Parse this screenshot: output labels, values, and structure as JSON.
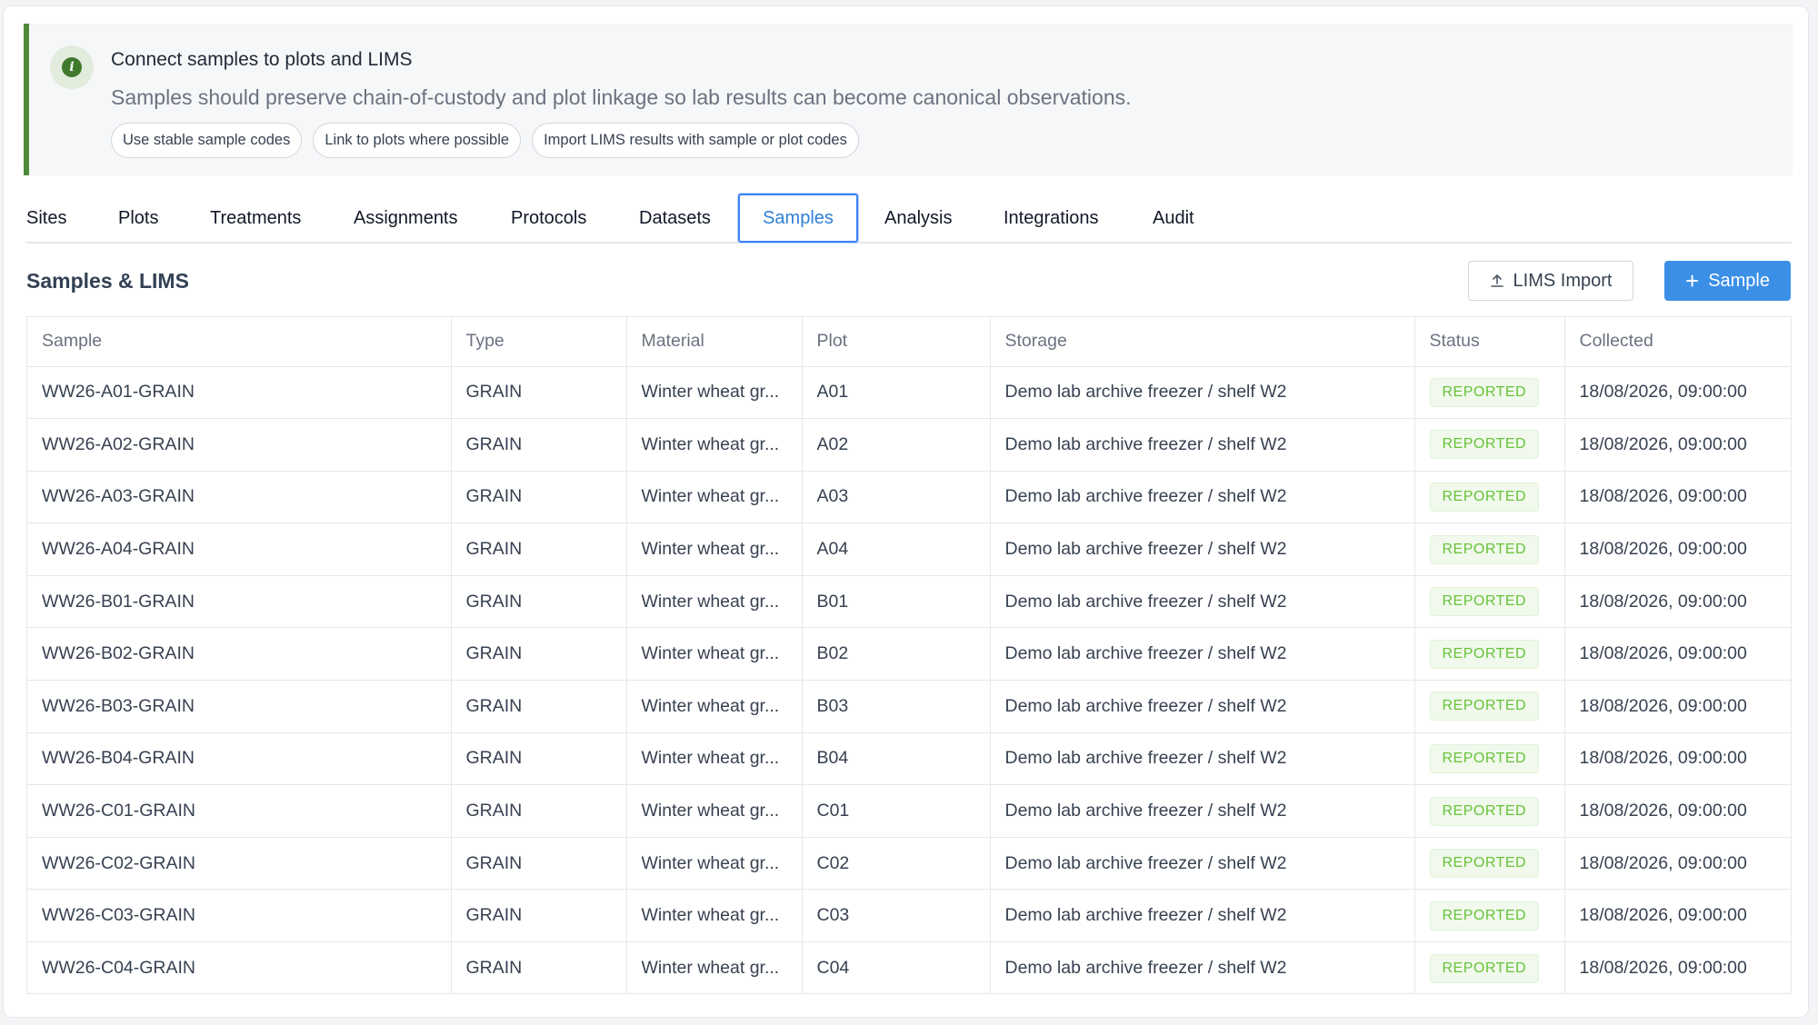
{
  "banner": {
    "title": "Connect samples to plots and LIMS",
    "description": "Samples should preserve chain-of-custody and plot linkage so lab results can become canonical observations.",
    "chips": [
      "Use stable sample codes",
      "Link to plots where possible",
      "Import LIMS results with sample or plot codes"
    ],
    "accent_color": "#4f8a3c"
  },
  "tabs": {
    "items": [
      "Sites",
      "Plots",
      "Treatments",
      "Assignments",
      "Protocols",
      "Datasets",
      "Samples",
      "Analysis",
      "Integrations",
      "Audit"
    ],
    "active": "Samples"
  },
  "section": {
    "title": "Samples & LIMS",
    "lims_import_label": "LIMS Import",
    "add_sample_label": "Sample",
    "primary_color": "#3b8fe6"
  },
  "table": {
    "columns": [
      "Sample",
      "Type",
      "Material",
      "Plot",
      "Storage",
      "Status",
      "Collected"
    ],
    "rows": [
      {
        "sample": "WW26-A01-GRAIN",
        "type": "GRAIN",
        "material": "Winter wheat gr...",
        "plot": "A01",
        "storage": "Demo lab archive freezer / shelf W2",
        "status": "REPORTED",
        "collected": "18/08/2026, 09:00:00"
      },
      {
        "sample": "WW26-A02-GRAIN",
        "type": "GRAIN",
        "material": "Winter wheat gr...",
        "plot": "A02",
        "storage": "Demo lab archive freezer / shelf W2",
        "status": "REPORTED",
        "collected": "18/08/2026, 09:00:00"
      },
      {
        "sample": "WW26-A03-GRAIN",
        "type": "GRAIN",
        "material": "Winter wheat gr...",
        "plot": "A03",
        "storage": "Demo lab archive freezer / shelf W2",
        "status": "REPORTED",
        "collected": "18/08/2026, 09:00:00"
      },
      {
        "sample": "WW26-A04-GRAIN",
        "type": "GRAIN",
        "material": "Winter wheat gr...",
        "plot": "A04",
        "storage": "Demo lab archive freezer / shelf W2",
        "status": "REPORTED",
        "collected": "18/08/2026, 09:00:00"
      },
      {
        "sample": "WW26-B01-GRAIN",
        "type": "GRAIN",
        "material": "Winter wheat gr...",
        "plot": "B01",
        "storage": "Demo lab archive freezer / shelf W2",
        "status": "REPORTED",
        "collected": "18/08/2026, 09:00:00"
      },
      {
        "sample": "WW26-B02-GRAIN",
        "type": "GRAIN",
        "material": "Winter wheat gr...",
        "plot": "B02",
        "storage": "Demo lab archive freezer / shelf W2",
        "status": "REPORTED",
        "collected": "18/08/2026, 09:00:00"
      },
      {
        "sample": "WW26-B03-GRAIN",
        "type": "GRAIN",
        "material": "Winter wheat gr...",
        "plot": "B03",
        "storage": "Demo lab archive freezer / shelf W2",
        "status": "REPORTED",
        "collected": "18/08/2026, 09:00:00"
      },
      {
        "sample": "WW26-B04-GRAIN",
        "type": "GRAIN",
        "material": "Winter wheat gr...",
        "plot": "B04",
        "storage": "Demo lab archive freezer / shelf W2",
        "status": "REPORTED",
        "collected": "18/08/2026, 09:00:00"
      },
      {
        "sample": "WW26-C01-GRAIN",
        "type": "GRAIN",
        "material": "Winter wheat gr...",
        "plot": "C01",
        "storage": "Demo lab archive freezer / shelf W2",
        "status": "REPORTED",
        "collected": "18/08/2026, 09:00:00"
      },
      {
        "sample": "WW26-C02-GRAIN",
        "type": "GRAIN",
        "material": "Winter wheat gr...",
        "plot": "C02",
        "storage": "Demo lab archive freezer / shelf W2",
        "status": "REPORTED",
        "collected": "18/08/2026, 09:00:00"
      },
      {
        "sample": "WW26-C03-GRAIN",
        "type": "GRAIN",
        "material": "Winter wheat gr...",
        "plot": "C03",
        "storage": "Demo lab archive freezer / shelf W2",
        "status": "REPORTED",
        "collected": "18/08/2026, 09:00:00"
      },
      {
        "sample": "WW26-C04-GRAIN",
        "type": "GRAIN",
        "material": "Winter wheat gr...",
        "plot": "C04",
        "storage": "Demo lab archive freezer / shelf W2",
        "status": "REPORTED",
        "collected": "18/08/2026, 09:00:00"
      }
    ],
    "status_color": "#67c23a"
  }
}
